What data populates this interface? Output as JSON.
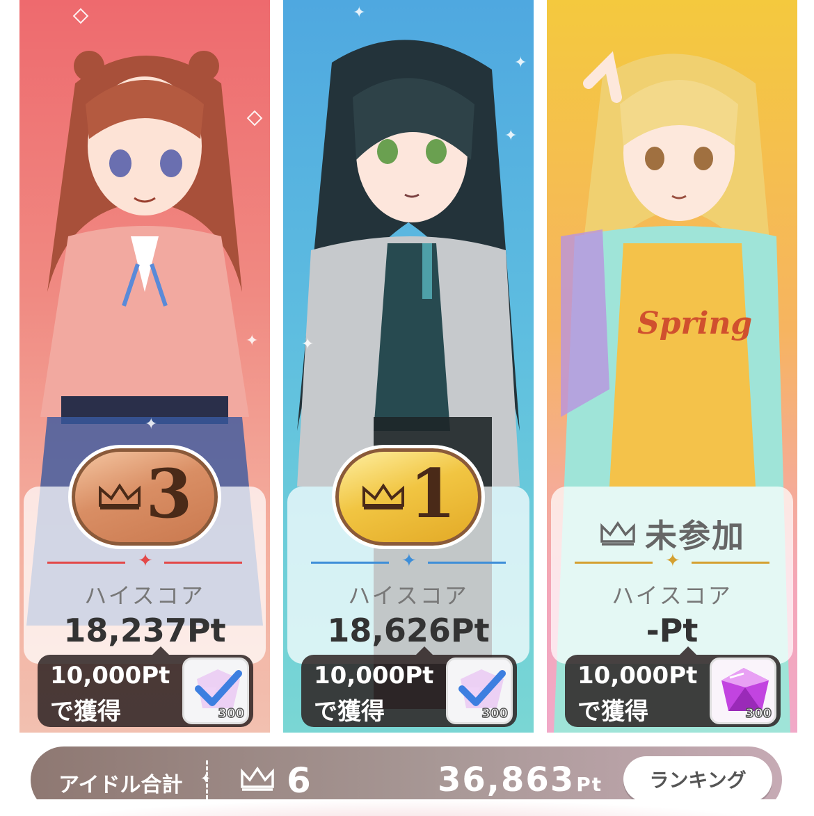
{
  "cards": [
    {
      "rank": "3",
      "medal": "bronze",
      "accent": "#e34848",
      "highscore_label": "ハイスコア",
      "highscore_value": "18,237Pt",
      "reward_line1": "10,000Pt",
      "reward_line2": "で獲得",
      "reward_amount": "300",
      "reward_claimed": true
    },
    {
      "rank": "1",
      "medal": "gold",
      "accent": "#3d8ed8",
      "highscore_label": "ハイスコア",
      "highscore_value": "18,626Pt",
      "reward_line1": "10,000Pt",
      "reward_line2": "で獲得",
      "reward_amount": "300",
      "reward_claimed": true
    },
    {
      "not_joined_label": "未参加",
      "accent": "#d4a030",
      "highscore_label": "ハイスコア",
      "highscore_value": "-Pt",
      "reward_line1": "10,000Pt",
      "reward_line2": "で獲得",
      "reward_amount": "300",
      "reward_claimed": false
    }
  ],
  "footer": {
    "total_label": "アイドル合計",
    "crown_count": "6",
    "points": "36,863",
    "points_unit": "Pt",
    "ranking_button": "ランキング"
  },
  "icons": {
    "crown": "crown-icon",
    "gem": "gem-icon",
    "check": "check-icon",
    "sparkle": "sparkle-icon"
  }
}
